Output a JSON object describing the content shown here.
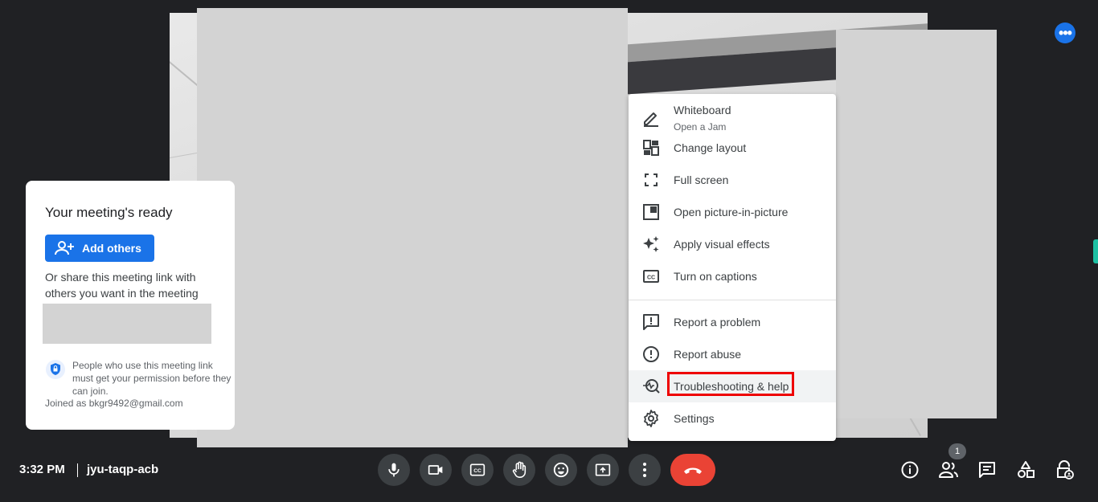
{
  "top": {
    "more_options_icon": "more-horiz-icon"
  },
  "ready_card": {
    "title": "Your meeting's ready",
    "add_others_label": "Add others",
    "share_text": "Or share this meeting link with others you want in the meeting",
    "people_text": "People who use this meeting link must get your permission before they can join.",
    "joined_as": "Joined as bkgr9492@gmail.com"
  },
  "menu": {
    "items": [
      {
        "label": "Whiteboard",
        "sublabel": "Open a Jam",
        "icon": "pencil-icon"
      },
      {
        "label": "Change layout",
        "icon": "layout-icon"
      },
      {
        "label": "Full screen",
        "icon": "fullscreen-icon"
      },
      {
        "label": "Open picture-in-picture",
        "icon": "picture-in-picture-icon"
      },
      {
        "label": "Apply visual effects",
        "icon": "sparkle-icon"
      },
      {
        "label": "Turn on captions",
        "icon": "captions-icon"
      },
      {
        "label": "Report a problem",
        "icon": "feedback-icon"
      },
      {
        "label": "Report abuse",
        "icon": "report-icon"
      },
      {
        "label": "Troubleshooting & help",
        "icon": "troubleshoot-icon"
      },
      {
        "label": "Settings",
        "icon": "gear-icon"
      }
    ]
  },
  "bottom": {
    "time": "3:32 PM",
    "meeting_code": "jyu-taqp-acb",
    "people_count": "1"
  },
  "colors": {
    "accent": "#1a73e8",
    "hangup": "#ea4335",
    "highlight": "#ee0000",
    "background": "#202124"
  }
}
